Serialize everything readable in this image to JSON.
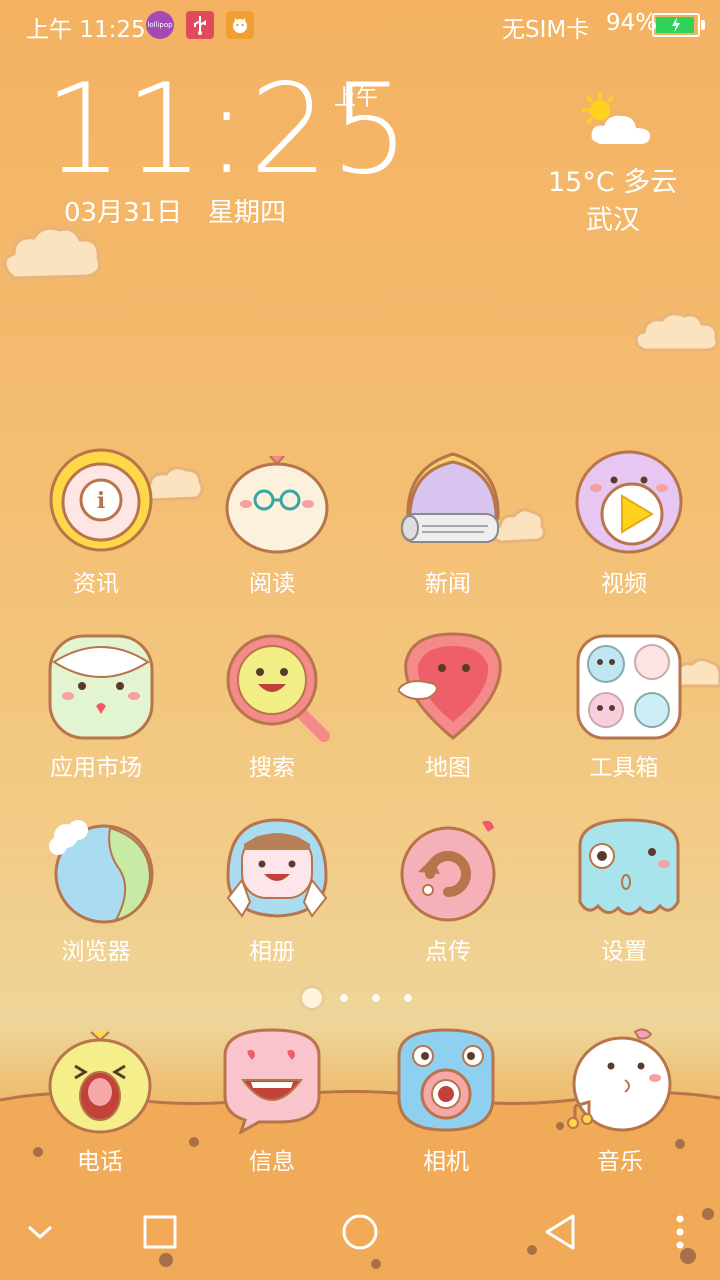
{
  "status_bar": {
    "time": "上午 11:25",
    "sim": "无SIM卡",
    "battery_percent": "94%",
    "battery_level": 0.94,
    "icons": [
      "lollipop-icon",
      "usb-icon",
      "android-notify-icon"
    ],
    "lollipop_label": "lollipop"
  },
  "clock_widget": {
    "time": "11:25",
    "ampm": "上午",
    "date": "03月31日",
    "weekday": "星期四"
  },
  "weather_widget": {
    "temperature_condition": "15°C 多云",
    "city": "武汉",
    "icon": "partly-cloudy-icon"
  },
  "apps": [
    {
      "label": "资讯",
      "icon": "info-icon"
    },
    {
      "label": "阅读",
      "icon": "reading-icon"
    },
    {
      "label": "新闻",
      "icon": "news-icon"
    },
    {
      "label": "视频",
      "icon": "video-play-icon"
    },
    {
      "label": "应用市场",
      "icon": "app-market-icon"
    },
    {
      "label": "搜索",
      "icon": "search-icon"
    },
    {
      "label": "地图",
      "icon": "map-icon"
    },
    {
      "label": "工具箱",
      "icon": "toolbox-icon"
    },
    {
      "label": "浏览器",
      "icon": "browser-globe-icon"
    },
    {
      "label": "相册",
      "icon": "gallery-icon"
    },
    {
      "label": "点传",
      "icon": "transfer-icon"
    },
    {
      "label": "设置",
      "icon": "settings-icon"
    }
  ],
  "page_indicator": {
    "pages": 4,
    "current": 1
  },
  "dock": [
    {
      "label": "电话",
      "icon": "phone-icon"
    },
    {
      "label": "信息",
      "icon": "messages-icon"
    },
    {
      "label": "相机",
      "icon": "camera-icon"
    },
    {
      "label": "音乐",
      "icon": "music-icon"
    }
  ],
  "nav_bar": [
    "collapse-chevron-icon",
    "recents-square-icon",
    "home-circle-icon",
    "back-triangle-icon",
    "more-dots-icon"
  ],
  "colors": {
    "background_top": "#f4b162",
    "background_mid": "#f2cb86",
    "ground": "#f2b25e",
    "outline": "#b8744a",
    "battery_green": "#2fd35a"
  }
}
